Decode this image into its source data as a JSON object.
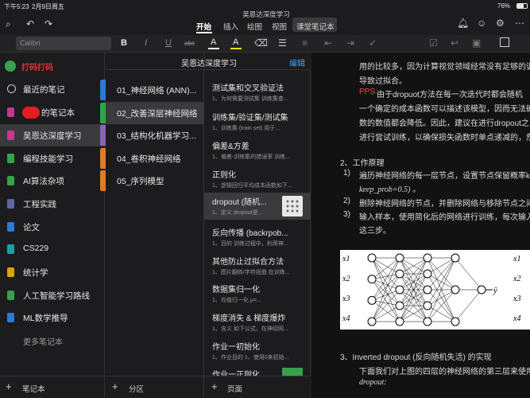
{
  "status": {
    "time": "下午5:23",
    "date": "2月9日周五",
    "battery": "76%"
  },
  "app": {
    "title": "吴恩达深度学习"
  },
  "ribbon_tabs": [
    "开始",
    "插入",
    "绘图",
    "视图",
    "课堂笔记本"
  ],
  "toolbar": {
    "font": "Calibri",
    "bold": "B",
    "italic": "I",
    "underline": "U",
    "strike": "abc",
    "fontcolor": "A",
    "highlight": "A"
  },
  "notebooks_header": {
    "account_initials": "打码打码",
    "more": "更多笔记本",
    "add": "笔记本"
  },
  "notebooks": [
    {
      "label": "最近的笔记",
      "color": "#8e8e93"
    },
    {
      "label": "的笔记本",
      "color": "#d13438"
    },
    {
      "label": "吴恩达深度学习",
      "color": "#c2398f"
    },
    {
      "label": "编程技能学习",
      "color": "#37a04c"
    },
    {
      "label": "AI算法杂项",
      "color": "#37a04c"
    },
    {
      "label": "工程实践",
      "color": "#6264a7"
    },
    {
      "label": "论文",
      "color": "#2f78d3"
    },
    {
      "label": "CS229",
      "color": "#1e9fa8"
    },
    {
      "label": "统计学",
      "color": "#d9a400"
    },
    {
      "label": "人工智能学习路线",
      "color": "#37a04c"
    },
    {
      "label": "ML数学推导",
      "color": "#2f78d3"
    }
  ],
  "sections_header": {
    "title": "吴恩达深度学习",
    "edit": "编辑",
    "add": "分区"
  },
  "sections": [
    {
      "label": "01_神经网络 (ANN)...",
      "color": "#2f78d3"
    },
    {
      "label": "02_改善深层神经网络",
      "color": "#37a04c"
    },
    {
      "label": "03_结构化机器学习...",
      "color": "#8764b8"
    },
    {
      "label": "04_卷积神经网络",
      "color": "#e07b24"
    },
    {
      "label": "05_序列模型",
      "color": "#e07b24"
    }
  ],
  "pages_footer": {
    "add": "页面"
  },
  "pages": [
    {
      "title": "测试集和交叉验证法",
      "sub": "1、为何需要测试集 训练集查..."
    },
    {
      "title": "训练集/验证集/测试集",
      "sub": "1、训练集 (train set) 用于..."
    },
    {
      "title": "偏差&方差",
      "sub": "1、偏差-训练集的错误率 训练..."
    },
    {
      "title": "正则化",
      "sub": "1、逻辑回归平均成本函数如下..."
    },
    {
      "title": "dropout (随机...",
      "sub": "1、定义 dropout是..."
    },
    {
      "title": "反向传播 (backrpob...",
      "sub": "1、目的 训练过程中，利用神..."
    },
    {
      "title": "其他防止过拟合方法",
      "sub": "1、图片翻转/字符扭曲 在训练..."
    },
    {
      "title": "数据集归一化",
      "sub": "1、均值归一化 μ=..."
    },
    {
      "title": "梯度消失 & 梯度爆炸",
      "sub": "1、含义 如下公式，在神经网..."
    },
    {
      "title": "作业一初始化",
      "sub": "1、作业目的 1、使用0来初始..."
    },
    {
      "title": "作业一正则化",
      "sub": ""
    }
  ],
  "document": {
    "lines": [
      "用的比较多，因为计算视觉领域经常没有足够的训",
      "导致过拟合。"
    ],
    "pps_label": "PPS:",
    "pps_lines": [
      "由于dropuot方法在每一次迭代时都会随机",
      "一个确定的成本函数可以描述该模型，因而无法确",
      "数的数值都会降低。因此，建议在进行dropout之",
      "进行尝试训练，以确保损失函数时单点递减的，然"
    ],
    "section2": "2、工作原理",
    "items": [
      {
        "num": "1)",
        "text": "遍历神经网络的每一层节点，设置节点保留概率ke"
      },
      {
        "num": "",
        "text": "keep_prob=0.5) 。"
      },
      {
        "num": "2)",
        "text": "删除神经网络的节点，并删除网络与移除节点之间"
      },
      {
        "num": "3)",
        "text": "输入样本，使用简化后的网络进行训练，每次输入"
      },
      {
        "num": "",
        "text": "这三步。"
      }
    ],
    "net_inputs": [
      "x1",
      "x2",
      "x3",
      "x4"
    ],
    "net_output": "ŷ",
    "section3": "3、Inverted dropout (反向随机失活) 的实现",
    "section3_line": "下面我们对上图的四层的神经网络的第三层来使用",
    "section3_line2": "dropout:"
  }
}
